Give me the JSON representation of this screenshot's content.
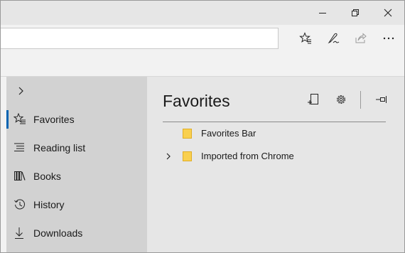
{
  "window_controls": {
    "minimize_icon": "minimize-icon",
    "maximize_icon": "restore-icon",
    "close_icon": "close-icon"
  },
  "toolbar": {
    "address_value": "",
    "buttons": [
      "favorites-star-icon",
      "pen-icon",
      "share-icon",
      "more-icon"
    ],
    "more_label": "···"
  },
  "hub": {
    "expand_icon": "chevron-right-icon",
    "nav": [
      {
        "label": "Favorites",
        "icon": "favorites-icon",
        "active": true
      },
      {
        "label": "Reading list",
        "icon": "reading-list-icon",
        "active": false
      },
      {
        "label": "Books",
        "icon": "books-icon",
        "active": false
      },
      {
        "label": "History",
        "icon": "history-icon",
        "active": false
      },
      {
        "label": "Downloads",
        "icon": "downloads-icon",
        "active": false
      }
    ],
    "accent_color": "#0063b1"
  },
  "content": {
    "title": "Favorites",
    "actions": [
      "add-to-favorites-icon",
      "settings-icon",
      "pin-icon"
    ],
    "items": [
      {
        "label": "Favorites Bar",
        "expandable": false
      },
      {
        "label": "Imported from Chrome",
        "expandable": true
      }
    ],
    "folder_color": "#f9d04f"
  }
}
